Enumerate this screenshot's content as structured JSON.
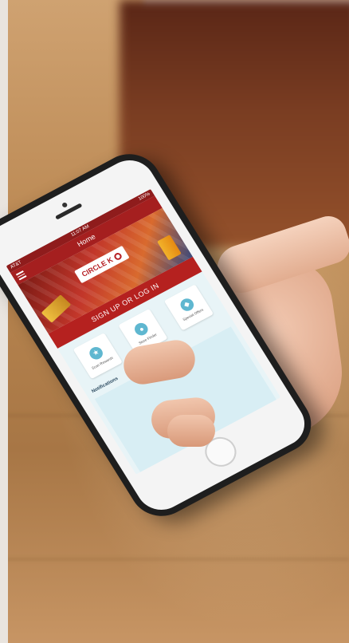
{
  "scene": {
    "description_colors": {
      "floor": "#b98650",
      "counter": "#7a3d22",
      "skin": "#e0a98c"
    }
  },
  "phone_screen": {
    "status_bar": {
      "left": "AT&T",
      "time": "11:07 AM",
      "right": "100%"
    },
    "nav": {
      "title": "Home",
      "menu_icon": "hamburger-icon"
    },
    "banner": {
      "logo_text": "CIRCLE K",
      "accent": "#b5211f"
    },
    "signup_label": "SIGN UP OR LOG IN",
    "tiles": [
      {
        "label": "Scan Rewards",
        "icon": "star-icon"
      },
      {
        "label": "Store Finder",
        "icon": "pin-icon"
      },
      {
        "label": "Special Offers",
        "icon": "tag-icon"
      }
    ],
    "section_title": "Notifications"
  }
}
